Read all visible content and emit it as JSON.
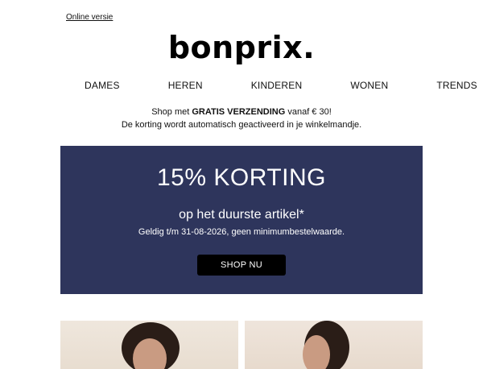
{
  "header": {
    "online_version": "Online versie",
    "logo_text": "bonprix."
  },
  "nav": {
    "items": [
      "DAMES",
      "HEREN",
      "KINDEREN",
      "WONEN",
      "TRENDS"
    ]
  },
  "promo": {
    "line1_prefix": "Shop met ",
    "line1_bold": "GRATIS VERZENDING",
    "line1_suffix": " vanaf € 30!",
    "line2": "De korting wordt automatisch geactiveerd in je winkelmandje."
  },
  "banner": {
    "title": "15% KORTING",
    "subtitle": "op het duurste artikel*",
    "terms": "Geldig t/m 31-08-2026, geen minimumbestelwaarde.",
    "cta": "SHOP NU",
    "background_color": "#2e355c"
  }
}
